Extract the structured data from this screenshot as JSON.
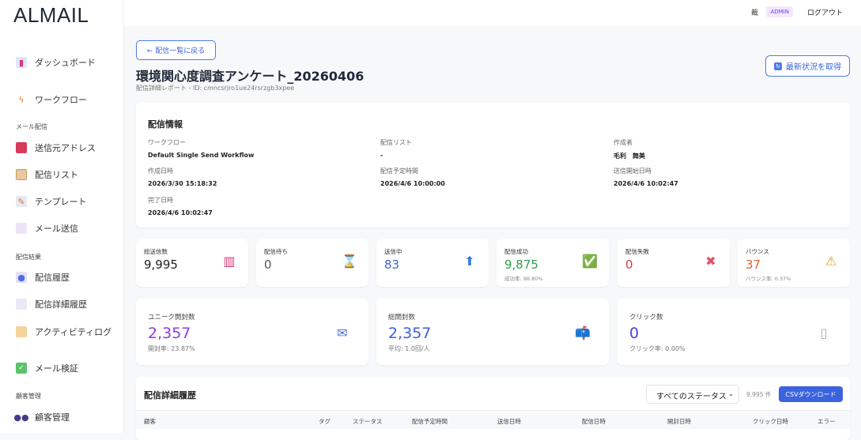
{
  "app": {
    "logo": "ALMAIL"
  },
  "sidebar": {
    "items": [
      {
        "label": "ダッシュボード",
        "icon": "bar-chart-icon"
      },
      {
        "label": "ワークフロー",
        "icon": "lightning-icon"
      },
      {
        "label": "送信元アドレス",
        "icon": "postbox-icon"
      },
      {
        "label": "配信リスト",
        "icon": "clipboard-icon"
      },
      {
        "label": "テンプレート",
        "icon": "document-pen-icon"
      },
      {
        "label": "メール送信",
        "icon": "envelope-icon"
      },
      {
        "label": "配信履歴",
        "icon": "email-at-icon"
      },
      {
        "label": "配信詳細履歴",
        "icon": "incoming-envelope-icon"
      },
      {
        "label": "アクティビティログ",
        "icon": "scroll-icon"
      },
      {
        "label": "メール検証",
        "icon": "check-box-icon"
      },
      {
        "label": "顧客管理",
        "icon": "users-icon"
      }
    ],
    "sections": [
      "メール配信",
      "配信結果",
      "顧客管理"
    ]
  },
  "header": {
    "user": "裁",
    "role": "ADMIN",
    "logout": "ログアウト"
  },
  "page": {
    "back": "← 配信一覧に戻る",
    "title": "環境関心度調査アンケート_20260406",
    "subtitle": "配信詳細レポート - ID: cmncsrjro1ue24rsrzgb3xpee",
    "refresh": "最新状況を取得"
  },
  "info": {
    "heading": "配信情報",
    "fields": [
      {
        "label": "ワークフロー",
        "value": "Default Single Send Workflow"
      },
      {
        "label": "配信リスト",
        "value": "-"
      },
      {
        "label": "作成者",
        "value": "毛利　舞美"
      },
      {
        "label": "作成日時",
        "value": "2026/3/30 15:18:32"
      },
      {
        "label": "配信予定時間",
        "value": "2026/4/6 10:00:00"
      },
      {
        "label": "送信開始日時",
        "value": "2026/4/6 10:02:47"
      },
      {
        "label": "完了日時",
        "value": "2026/4/6 10:02:47"
      }
    ]
  },
  "stats": [
    {
      "label": "総送信数",
      "value": "9,995",
      "sub": "",
      "color": "#222222"
    },
    {
      "label": "配信待ち",
      "value": "0",
      "sub": "",
      "color": "#555555"
    },
    {
      "label": "送信中",
      "value": "83",
      "sub": "",
      "color": "#3b63d8"
    },
    {
      "label": "配信成功",
      "value": "9,875",
      "sub": "成功率: 98.80%",
      "color": "#2e9e4a"
    },
    {
      "label": "配信失敗",
      "value": "0",
      "sub": "",
      "color": "#d63a3a"
    },
    {
      "label": "バウンス",
      "value": "37",
      "sub": "バウンス率: 0.37%",
      "color": "#e0622a"
    }
  ],
  "engagement": [
    {
      "label": "ユニーク開封数",
      "value": "2,357",
      "sub": "開封率: 23.87%",
      "color": "#8a3ee0"
    },
    {
      "label": "総開封数",
      "value": "2,357",
      "sub": "平均: 1.0回/人",
      "color": "#3b5fe0"
    },
    {
      "label": "クリック数",
      "value": "0",
      "sub": "クリック率: 0.00%",
      "color": "#4a3ee0"
    }
  ],
  "table": {
    "heading": "配信詳細履歴",
    "filter": "すべてのステータス",
    "count": "9,995 件",
    "csv": "CSVダウンロード",
    "columns": [
      "顧客",
      "タグ",
      "ステータス",
      "配信予定時間",
      "送信日時",
      "配信日時",
      "開封日時",
      "クリック日時",
      "エラー"
    ]
  }
}
